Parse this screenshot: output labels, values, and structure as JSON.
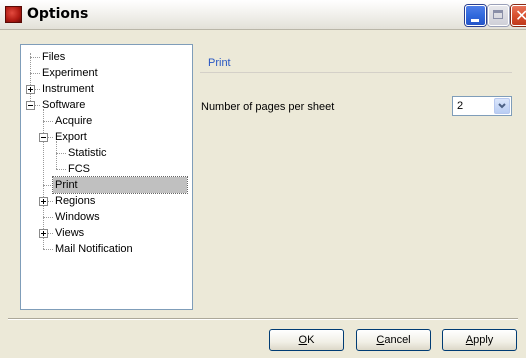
{
  "window": {
    "title": "Options"
  },
  "tree": {
    "items": [
      {
        "label": "Files",
        "level": 0,
        "expander": "none"
      },
      {
        "label": "Experiment",
        "level": 0,
        "expander": "none"
      },
      {
        "label": "Instrument",
        "level": 0,
        "expander": "collapsed"
      },
      {
        "label": "Software",
        "level": 0,
        "expander": "expanded"
      },
      {
        "label": "Acquire",
        "level": 1,
        "expander": "none"
      },
      {
        "label": "Export",
        "level": 1,
        "expander": "expanded"
      },
      {
        "label": "Statistic",
        "level": 2,
        "expander": "none"
      },
      {
        "label": "FCS",
        "level": 2,
        "expander": "none"
      },
      {
        "label": "Print",
        "level": 1,
        "expander": "none",
        "selected": true
      },
      {
        "label": "Regions",
        "level": 1,
        "expander": "collapsed"
      },
      {
        "label": "Windows",
        "level": 1,
        "expander": "none"
      },
      {
        "label": "Views",
        "level": 1,
        "expander": "collapsed"
      },
      {
        "label": "Mail Notification",
        "level": 1,
        "expander": "none"
      }
    ]
  },
  "panel": {
    "section_title": "Print",
    "field_label": "Number of pages per sheet",
    "pages_per_sheet": "2"
  },
  "buttons": {
    "ok_accel": "O",
    "ok_rest": "K",
    "cancel_accel": "C",
    "cancel_rest": "ancel",
    "apply_accel": "A",
    "apply_rest": "pply"
  },
  "colors": {
    "section_title": "#2857c3",
    "selection": "#c0c0c0",
    "dialog_bg": "#ece9d8"
  },
  "icons": {
    "app": "app-icon",
    "minimize": "minimize-icon",
    "maximize": "maximize-icon",
    "close": "close-icon",
    "dropdown": "chevron-down-icon"
  }
}
